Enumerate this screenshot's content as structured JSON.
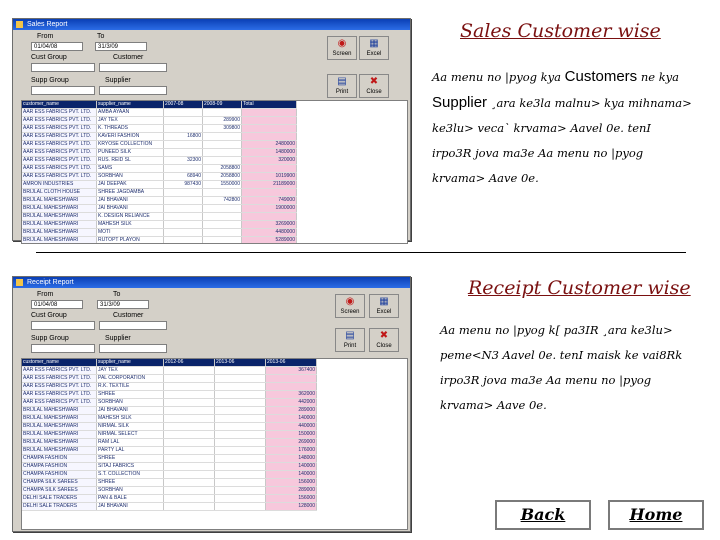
{
  "slide1": {
    "title": "Sales Customer wise",
    "para_pre": "Aa menu no |pyog kya",
    "customers": "Customers",
    "para_mid1": "ne kya",
    "supplier": "Supplier",
    "para_rest": "¸ara ke3la malnu> kya mihnama> ke3lu> veca` krvama> Aavel 0e. tenI irpo3R jova ma3e Aa menu no |pyog krvama> Aave 0e.",
    "window": {
      "title": "Sales Report",
      "from_label": "From",
      "to_label": "To",
      "from_value": "01/04/08",
      "to_value": "31/3/09",
      "cust_group_label": "Cust Group",
      "customer_label": "Customer",
      "supp_group_label": "Supp Group",
      "supplier_label": "Supplier",
      "buttons": [
        {
          "label": "Screen",
          "icon": "screen-icon"
        },
        {
          "label": "Excel",
          "icon": "excel-icon"
        },
        {
          "label": "Print",
          "icon": "print-icon"
        },
        {
          "label": "Close",
          "icon": "close-icon"
        }
      ],
      "headers": [
        "customer_name",
        "supplier_name",
        "2007-08",
        "2008-09",
        "Total"
      ],
      "rows": [
        [
          "AAR ESS FABRICS PVT. LTD.",
          "AMBA AYAAN",
          "",
          "",
          ""
        ],
        [
          "AAR ESS FABRICS PVT. LTD.",
          "JAY TEX",
          "",
          "289900",
          ""
        ],
        [
          "AAR ESS FABRICS PVT. LTD.",
          "K. THREADS",
          "",
          "309800",
          ""
        ],
        [
          "AAR ESS FABRICS PVT. LTD.",
          "KAVERI FASHION",
          "16800",
          "",
          ""
        ],
        [
          "AAR ESS FABRICS PVT. LTD.",
          "KRYOSE COLLECTION",
          "",
          "",
          "2480000"
        ],
        [
          "AAR ESS FABRICS PVT. LTD.",
          "PUNEED SILK",
          "",
          "",
          "1480000"
        ],
        [
          "AAR ESS FABRICS PVT. LTD.",
          "RUS. REID SL",
          "32300",
          "",
          "320000"
        ],
        [
          "AAR ESS FABRICS PVT. LTD.",
          "SAMS",
          "",
          "2058800",
          ""
        ],
        [
          "AAR ESS FABRICS PVT. LTD.",
          "SORBHAN",
          "68940",
          "2058800",
          "1019900"
        ],
        [
          "AMRON INDUSTRIES",
          "JAI DEEPAK",
          "987430",
          "1550000",
          "21189000"
        ],
        [
          "BRIJLAL CLOTH HOUSE",
          "SHREE JAGDAMBA",
          "",
          "",
          ""
        ],
        [
          "BRIJLAL MAHESHWARI",
          "JAI BHAVANI",
          "",
          "742800",
          "749000"
        ],
        [
          "BRIJLAL MAHESHWARI",
          "JAI BHAVANI",
          "",
          "",
          "1900000"
        ],
        [
          "BRIJLAL MAHESHWARI",
          "K. DESIGN RELIANCE",
          "",
          "",
          ""
        ],
        [
          "BRIJLAL MAHESHWARI",
          "MAHESH SILK",
          "",
          "",
          "3269000"
        ],
        [
          "BRIJLAL MAHESHWARI",
          "MOTI",
          "",
          "",
          "4480000"
        ],
        [
          "BRIJLAL MAHESHWARI",
          "RUTOPT PLAYON",
          "",
          "",
          "5289000"
        ],
        [
          "BRIJLAL MAHESHWARI",
          "R. WHITE STAR",
          "35900",
          "",
          "5199000"
        ],
        [
          "BRIJLAL MAHESHWARI",
          "RUPAM FABRIC",
          "",
          "378900",
          "4409000"
        ],
        [
          "BRIJLAL MAHESHWARI",
          "SHREE RAM",
          "53840",
          "1209000",
          "3149000"
        ],
        [
          "BRIJLAL MAHESHWARI",
          "VIMAL SILK",
          "",
          "",
          ""
        ]
      ]
    }
  },
  "slide2": {
    "title": "Receipt Customer wise",
    "para": "Aa menu no |pyog k[ pa3IR ¸ara ke3lu> peme<N3 Aavel 0e. tenI maisk ke vai8Rk irpo3R jova ma3e Aa menu no |pyog krvama> Aave 0e.",
    "window": {
      "title": "Receipt Report",
      "from_label": "From",
      "to_label": "To",
      "from_value": "01/04/08",
      "to_value": "31/3/09",
      "cust_group_label": "Cust Group",
      "customer_label": "Customer",
      "supp_group_label": "Supp Group",
      "supplier_label": "Supplier",
      "buttons": [
        {
          "label": "Screen",
          "icon": "screen-icon"
        },
        {
          "label": "Excel",
          "icon": "excel-icon"
        },
        {
          "label": "Print",
          "icon": "print-icon"
        },
        {
          "label": "Close",
          "icon": "close-icon"
        }
      ],
      "headers": [
        "customer_name",
        "supplier_name",
        "2012-06",
        "2013-06",
        "2013-06"
      ],
      "rows": [
        [
          "AAR ESS FABRICS PVT. LTD.",
          "JAY TEX",
          "",
          "",
          "367400"
        ],
        [
          "AAR ESS FABRICS PVT. LTD.",
          "PAL CORPORATION",
          "",
          "",
          ""
        ],
        [
          "AAR ESS FABRICS PVT. LTD.",
          "R.K. TEXTILE",
          "",
          "",
          ""
        ],
        [
          "AAR ESS FABRICS PVT. LTD.",
          "SHREE",
          "",
          "",
          "362000"
        ],
        [
          "AAR ESS FABRICS PVT. LTD.",
          "SORBHAN",
          "",
          "",
          "442000"
        ],
        [
          "BRIJLAL MAHESHWARI",
          "JAI BHAVANI",
          "",
          "",
          "289000"
        ],
        [
          "BRIJLAL MAHESHWARI",
          "MAHESH SILK",
          "",
          "",
          "140000"
        ],
        [
          "BRIJLAL MAHESHWARI",
          "NIRMAL SILK",
          "",
          "",
          "440000"
        ],
        [
          "BRIJLAL MAHESHWARI",
          "NIRMAL SELECT",
          "",
          "",
          "150000"
        ],
        [
          "BRIJLAL MAHESHWARI",
          "RAM LAL",
          "",
          "",
          "269000"
        ],
        [
          "BRIJLAL MAHESHWARI",
          "PARTY LAL",
          "",
          "",
          "176000"
        ],
        [
          "CHAMPA FASHION",
          "SHREE",
          "",
          "",
          "148000"
        ],
        [
          "CHAMPA FASHION",
          "SITAJ FABRICS",
          "",
          "",
          "140000"
        ],
        [
          "CHAMPA FASHION",
          "S.T. COLLECTION",
          "",
          "",
          "140000"
        ],
        [
          "CHAMPA SILK SAREES",
          "SHREE",
          "",
          "",
          "156000"
        ],
        [
          "CHAMPA SILK SAREES",
          "SORBHAN",
          "",
          "",
          "289000"
        ],
        [
          "DELHI SALE TRADERS",
          "PAN & BALE",
          "",
          "",
          "156000"
        ],
        [
          "DELHI SALE TRADERS",
          "JAI BHAVANI",
          "",
          "",
          "128000"
        ]
      ]
    }
  },
  "nav": {
    "back": "Back",
    "home": "Home"
  }
}
